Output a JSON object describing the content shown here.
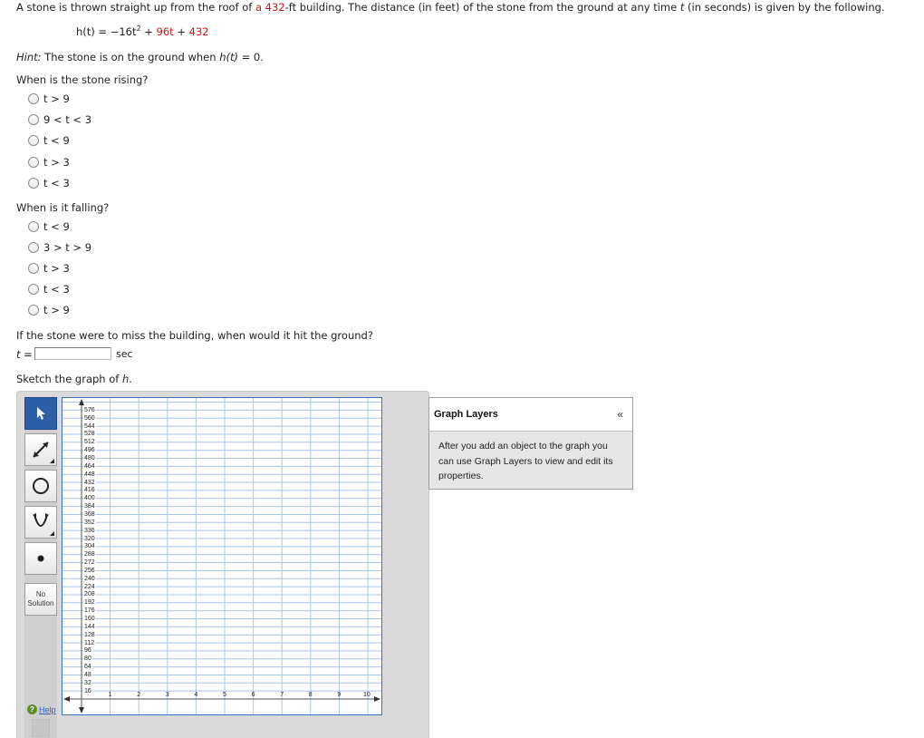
{
  "problem": {
    "intro_a": "A stone is thrown straight up from the roof of ",
    "intro_b": "a 432",
    "intro_c": "-ft building. The distance (in feet) of the stone from the ground at any time ",
    "intro_t": "t",
    "intro_d": " (in seconds) is given by the following.",
    "formula_lhs": "h(t) = −16t",
    "formula_exp": "2",
    "formula_mid": " + ",
    "formula_b": "96t",
    "formula_plus": " + ",
    "formula_c": "432",
    "hint_label": "Hint:",
    "hint_a": " The stone is on the ground when ",
    "hint_h": "h(t)",
    "hint_b": " = 0."
  },
  "q1": {
    "prompt": "When is the stone rising?",
    "options": [
      "t > 9",
      "9 < t < 3",
      "t < 9",
      "t > 3",
      "t < 3"
    ]
  },
  "q2": {
    "prompt": "When is it falling?",
    "options": [
      "t < 9",
      "3 > t > 9",
      "t > 3",
      "t < 3",
      "t > 9"
    ]
  },
  "q3": {
    "prompt": "If the stone were to miss the building, when would it hit the ground?",
    "var_label": "t =",
    "input_value": "",
    "unit": "sec"
  },
  "q4": {
    "prompt_a": "Sketch the graph of ",
    "prompt_h": "h",
    "prompt_b": "."
  },
  "graph_tool": {
    "no_solution_line1": "No",
    "no_solution_line2": "Solution",
    "help_label": "Help",
    "tools": [
      "pointer-icon",
      "line-ray-icon",
      "circle-icon",
      "parabola-icon",
      "point-icon"
    ],
    "y_ticks": [
      576,
      560,
      544,
      528,
      512,
      496,
      480,
      464,
      448,
      432,
      416,
      400,
      384,
      368,
      352,
      336,
      320,
      304,
      288,
      272,
      256,
      240,
      224,
      208,
      192,
      176,
      160,
      144,
      128,
      112,
      96,
      80,
      64,
      48,
      32,
      16
    ],
    "x_ticks": [
      1,
      2,
      3,
      4,
      5,
      6,
      7,
      8,
      9,
      10
    ],
    "y_max": 576,
    "y_step": 16,
    "x_max": 10,
    "x_step": 1,
    "grid_color": "#a9c6ec",
    "axis_color": "#555555"
  },
  "layers": {
    "title": "Graph Layers",
    "collapse_glyph": "«",
    "body": "After you add an object to the graph you can use Graph Layers to view and edit its properties."
  },
  "colors": {
    "accent_red": "#c8141e",
    "tool_active": "#2d5fa6",
    "help_link": "#2a62b8"
  }
}
